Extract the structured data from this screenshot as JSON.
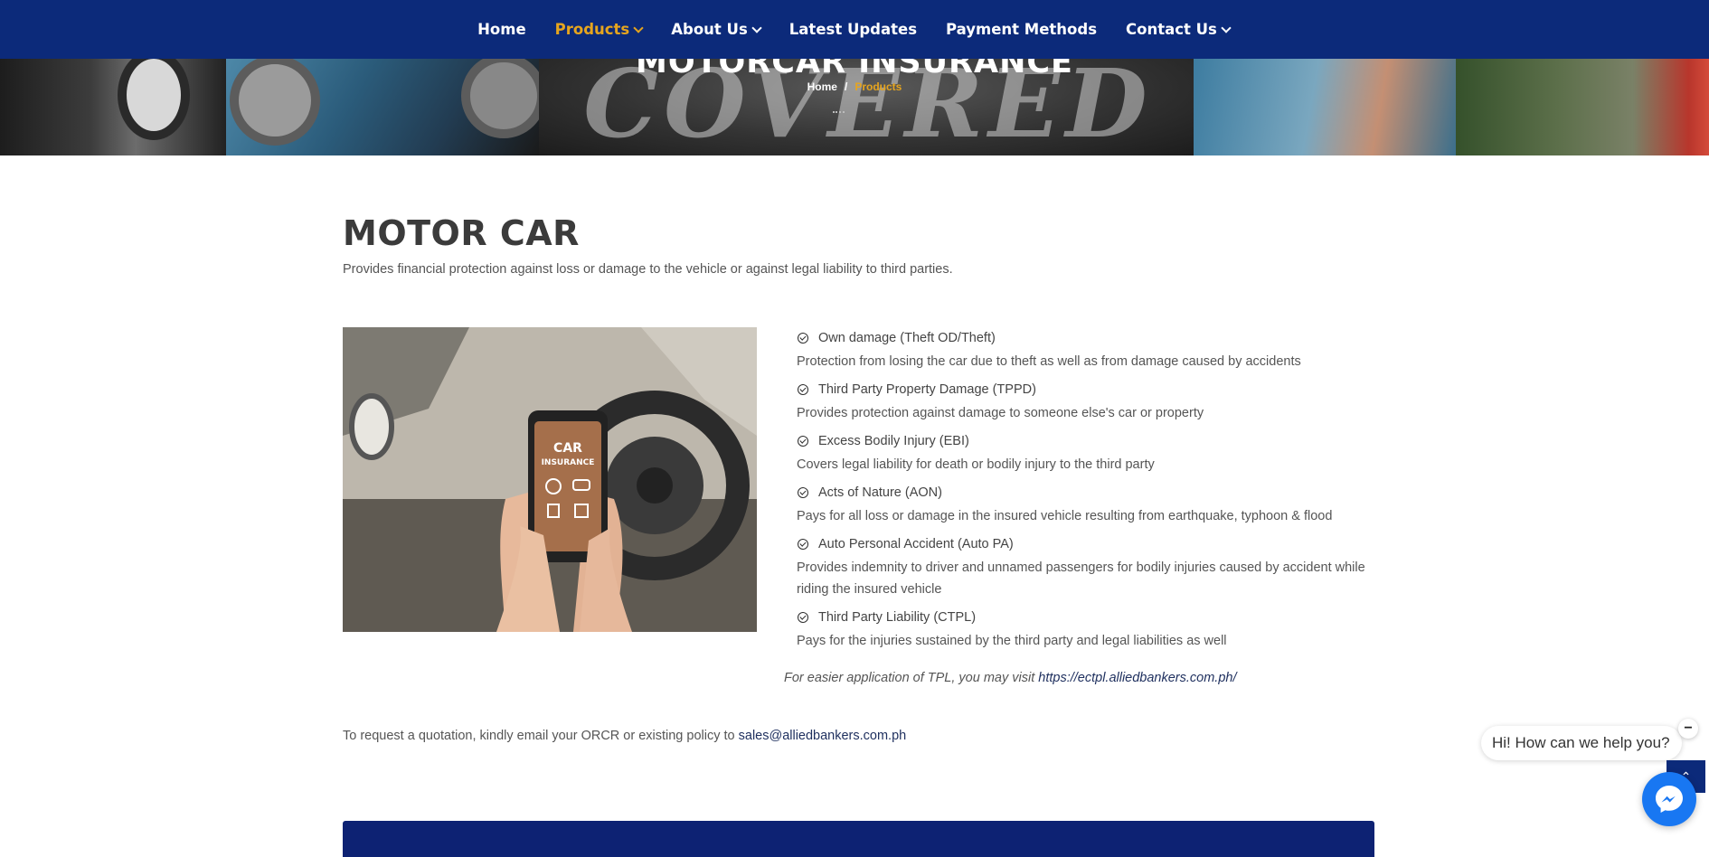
{
  "nav": {
    "items": [
      {
        "label": "Home",
        "dropdown": false,
        "active": false
      },
      {
        "label": "Products",
        "dropdown": true,
        "active": true
      },
      {
        "label": "About Us",
        "dropdown": true,
        "active": false
      },
      {
        "label": "Latest Updates",
        "dropdown": false,
        "active": false
      },
      {
        "label": "Payment Methods",
        "dropdown": false,
        "active": false
      },
      {
        "label": "Contact Us",
        "dropdown": true,
        "active": false
      }
    ]
  },
  "hero": {
    "title": "MOTORCAR INSURANCE",
    "banner_text": "COVERED",
    "breadcrumb": {
      "home": "Home",
      "separator": "/",
      "current": "Products"
    }
  },
  "main": {
    "title": "MOTOR CAR",
    "intro": "Provides financial protection against loss or damage to the vehicle or against legal liability to third parties.",
    "phone_screen": {
      "line1": "CAR",
      "line2": "INSURANCE"
    },
    "features": [
      {
        "title": "Own damage (Theft OD/Theft)",
        "desc": "Protection from losing the car due to theft as well as from damage caused by accidents"
      },
      {
        "title": "Third Party Property Damage (TPPD)",
        "desc": "Provides protection against damage to someone else's car or property"
      },
      {
        "title": "Excess Bodily Injury (EBI)",
        "desc": "Covers legal liability for death or bodily injury to the third party"
      },
      {
        "title": "Acts of Nature (AON)",
        "desc": "Pays for all loss or damage in the insured vehicle resulting from earthquake, typhoon & flood"
      },
      {
        "title": "Auto Personal Accident (Auto PA)",
        "desc": "Provides indemnity to driver and unnamed passengers for bodily injuries caused by accident while riding the insured vehicle"
      },
      {
        "title": "Third Party Liability (CTPL)",
        "desc": "Pays for the injuries sustained by the third party and legal liabilities as well"
      }
    ],
    "tpl_note": {
      "text": "For easier application of TPL, you may visit ",
      "link": "https://ectpl.alliedbankers.com.ph/"
    },
    "quote": {
      "text": "To request a quotation, kindly email your ORCR or existing policy to ",
      "email": "sales@alliedbankers.com.ph"
    }
  },
  "chat": {
    "greeting": "Hi! How can we help you?",
    "close_symbol": "−",
    "scroll_symbol": "⌃"
  },
  "colors": {
    "nav_bg": "#0c2a7a",
    "accent": "#e6a51e",
    "link": "#1e2f5e",
    "messenger": "#1877f2",
    "footer_band": "#0d2273"
  }
}
